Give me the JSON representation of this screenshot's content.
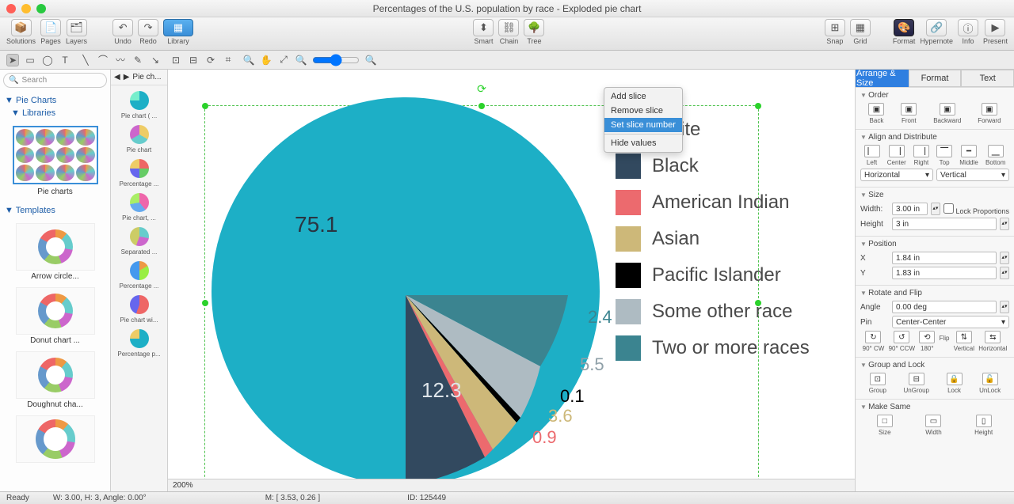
{
  "window": {
    "title": "Percentages of the U.S. population by race - Exploded pie chart"
  },
  "toolbar": {
    "solutions": "Solutions",
    "pages": "Pages",
    "layers": "Layers",
    "undo": "Undo",
    "redo": "Redo",
    "library": "Library",
    "smart": "Smart",
    "chain": "Chain",
    "tree": "Tree",
    "snap": "Snap",
    "grid": "Grid",
    "format": "Format",
    "hypernote": "Hypernote",
    "info": "Info",
    "present": "Present"
  },
  "left": {
    "search_placeholder": "Search",
    "pie_charts": "Pie Charts",
    "libraries": "Libraries",
    "pie_charts_lbl": "Pie charts",
    "templates": "Templates",
    "tpl1": "Arrow circle...",
    "tpl2": "Donut chart ...",
    "tpl3": "Doughnut cha..."
  },
  "thumbs": {
    "breadcrumb": "Pie ch...",
    "items": [
      "Pie chart ( ...",
      "Pie chart",
      "Percentage ...",
      "Pie chart, ...",
      "Separated ...",
      "Percentage ...",
      "Pie chart wi...",
      "Percentage p..."
    ]
  },
  "context_menu": {
    "add": "Add slice",
    "remove": "Remove slice",
    "set": "Set slice number",
    "hide": "Hide values"
  },
  "inspector": {
    "tabs": {
      "arrange": "Arrange & Size",
      "format": "Format",
      "text": "Text"
    },
    "order": {
      "title": "Order",
      "back": "Back",
      "front": "Front",
      "backward": "Backward",
      "forward": "Forward"
    },
    "align": {
      "title": "Align and Distribute",
      "left": "Left",
      "center": "Center",
      "right": "Right",
      "top": "Top",
      "middle": "Middle",
      "bottom": "Bottom",
      "horiz": "Horizontal",
      "vert": "Vertical"
    },
    "size": {
      "title": "Size",
      "width_lbl": "Width:",
      "width": "3.00 in",
      "height_lbl": "Height",
      "height": "3 in",
      "lock": "Lock Proportions"
    },
    "position": {
      "title": "Position",
      "x_lbl": "X",
      "x": "1.84 in",
      "y_lbl": "Y",
      "y": "1.83 in"
    },
    "rotate": {
      "title": "Rotate and Flip",
      "angle_lbl": "Angle",
      "angle": "0.00 deg",
      "pin_lbl": "Pin",
      "pin": "Center-Center",
      "cw": "90° CW",
      "ccw": "90° CCW",
      "r180": "180°",
      "flip": "Flip",
      "v": "Vertical",
      "h": "Horizontal"
    },
    "group": {
      "title": "Group and Lock",
      "group": "Group",
      "ungroup": "UnGroup",
      "lock": "Lock",
      "unlock": "UnLock"
    },
    "same": {
      "title": "Make Same",
      "size": "Size",
      "width": "Width",
      "height": "Height"
    }
  },
  "status": {
    "ready": "Ready",
    "wha": "W: 3.00,  H: 3,  Angle: 0.00°",
    "zoom": "200%",
    "mouse": "M: [ 3.53, 0.26 ]",
    "id": "ID: 125449"
  },
  "chart_data": {
    "type": "pie",
    "title": "Percentages of the U.S. population by race",
    "exploded": true,
    "series": [
      {
        "name": "White",
        "value": 75.1,
        "color": "#1dafc6"
      },
      {
        "name": "Black",
        "value": 12.3,
        "color": "#32495f"
      },
      {
        "name": "American Indian",
        "value": 0.9,
        "color": "#ec6a6e"
      },
      {
        "name": "Asian",
        "value": 3.6,
        "color": "#cdb879"
      },
      {
        "name": "Pacific Islander",
        "value": 0.1,
        "color": "#000000"
      },
      {
        "name": "Some other race",
        "value": 5.5,
        "color": "#aebbc2"
      },
      {
        "name": "Two or more races",
        "value": 2.4,
        "color": "#3b8490"
      }
    ]
  }
}
